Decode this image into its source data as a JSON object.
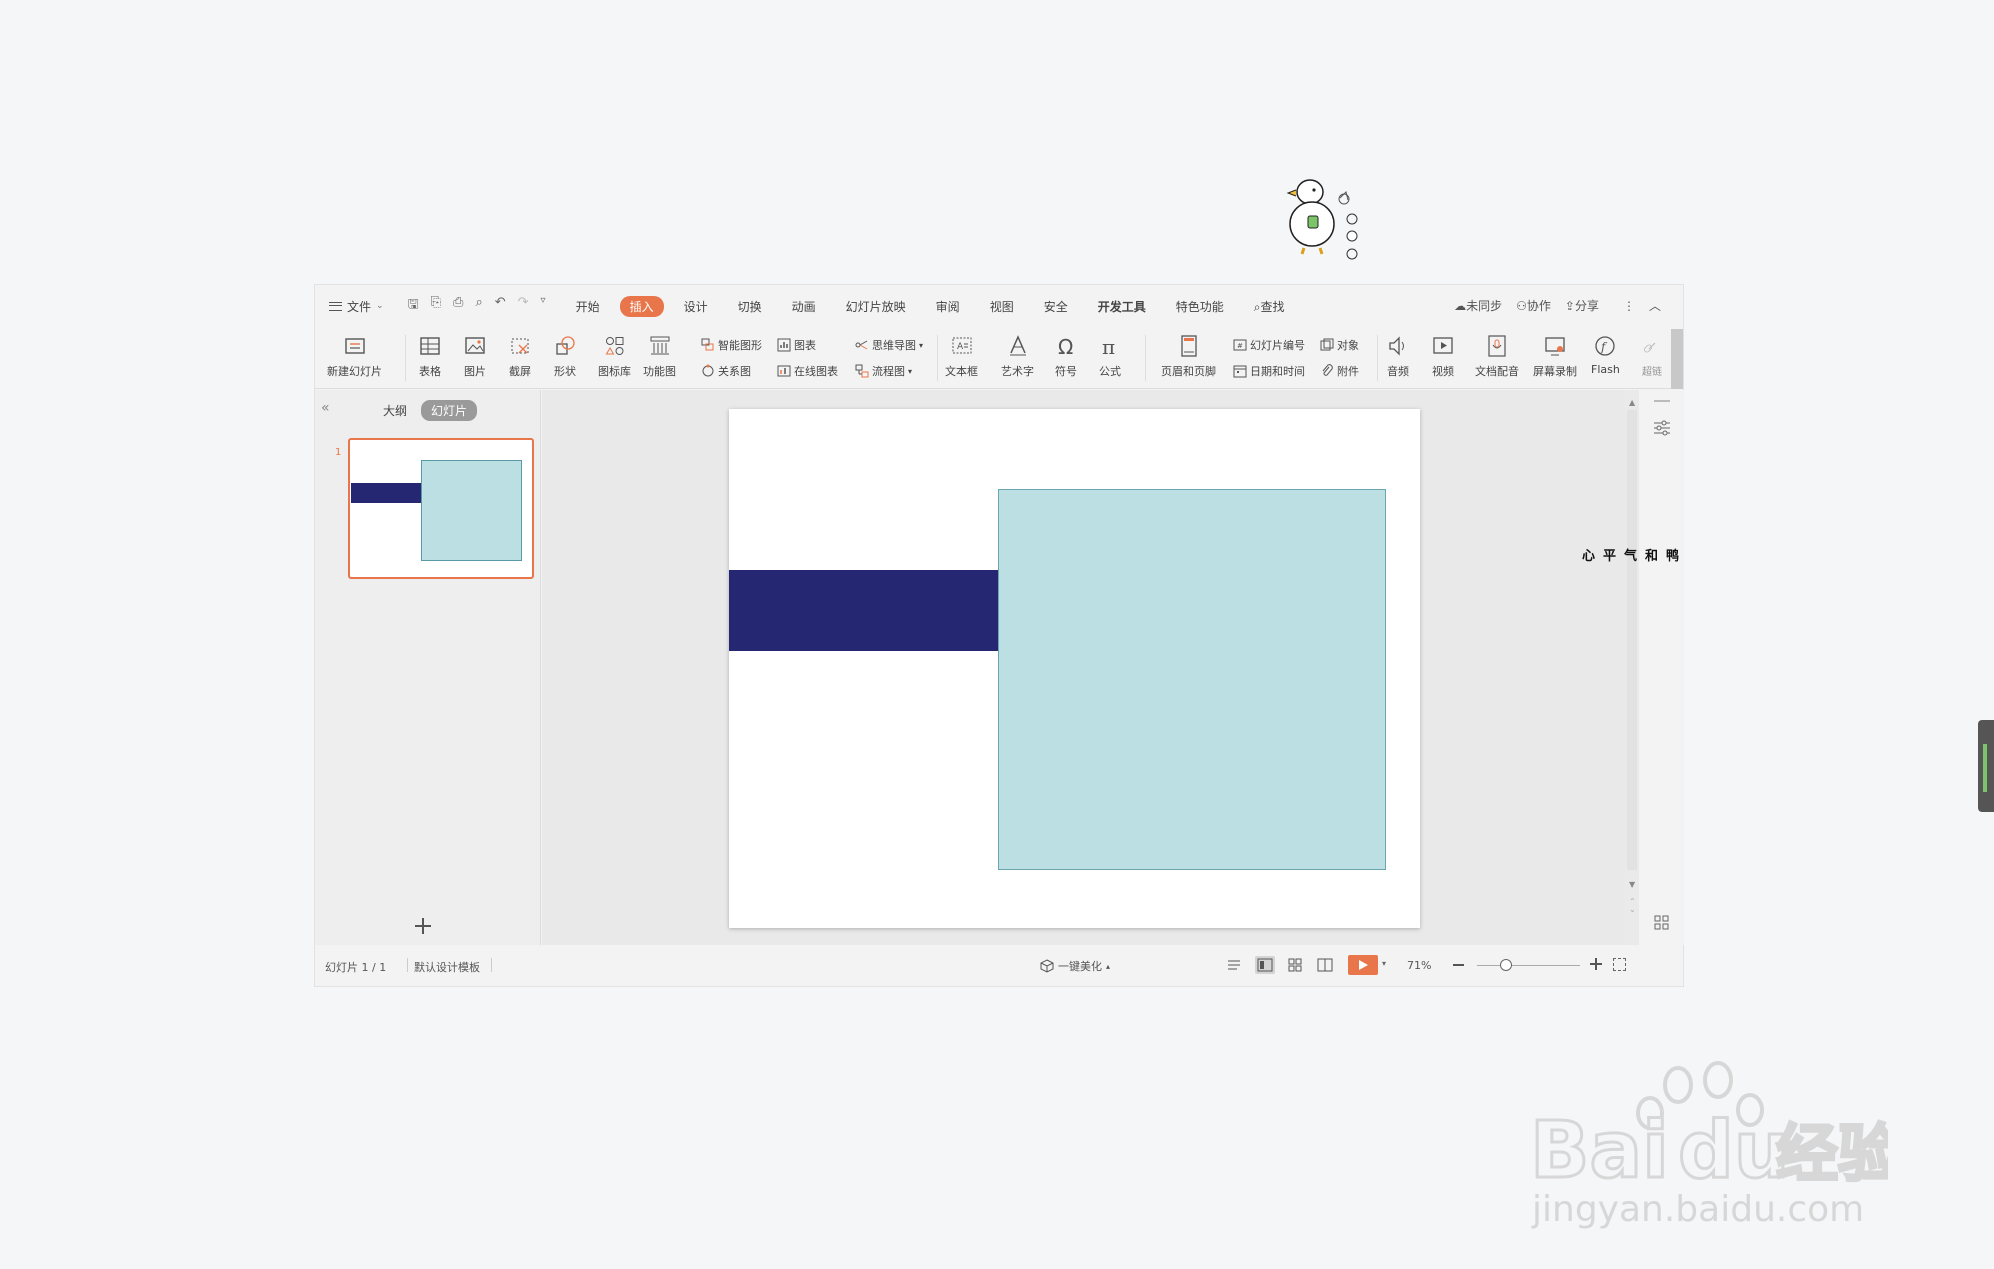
{
  "menubar": {
    "file_label": "文件",
    "tabs": [
      {
        "label": "开始"
      },
      {
        "label": "插入"
      },
      {
        "label": "设计"
      },
      {
        "label": "切换"
      },
      {
        "label": "动画"
      },
      {
        "label": "幻灯片放映"
      },
      {
        "label": "审阅"
      },
      {
        "label": "视图"
      },
      {
        "label": "安全"
      },
      {
        "label": "开发工具"
      },
      {
        "label": "特色功能"
      }
    ],
    "search_label": "查找",
    "sync_label": "未同步",
    "collab_label": "协作",
    "share_label": "分享"
  },
  "ribbon": {
    "new_slide": "新建幻灯片",
    "table": "表格",
    "picture": "图片",
    "screenshot": "截屏",
    "shape": "形状",
    "icon_lib": "图标库",
    "func_chart": "功能图",
    "smart_art": "智能图形",
    "chart": "图表",
    "relation": "关系图",
    "online_chart": "在线图表",
    "mindmap": "思维导图",
    "flowchart": "流程图",
    "textbox": "文本框",
    "wordart": "艺术字",
    "symbol": "符号",
    "formula": "公式",
    "header_footer": "页眉和页脚",
    "slide_number": "幻灯片编号",
    "object": "对象",
    "date_time": "日期和时间",
    "attachment": "附件",
    "audio": "音频",
    "video": "视频",
    "doc_dub": "文档配音",
    "screen_rec": "屏幕录制",
    "flash": "Flash",
    "hyperlink": "超链"
  },
  "leftpanel": {
    "outline_tab": "大纲",
    "slides_tab": "幻灯片",
    "thumb_number": "1"
  },
  "statusbar": {
    "slide_info": "幻灯片 1 / 1",
    "template": "默认设计模板",
    "beautify": "一键美化",
    "zoom": "71%"
  },
  "sticker": {
    "caption": "心平气和鸭"
  },
  "watermark": {
    "brand": "Baidu",
    "brand_cn": "经验",
    "url": "jingyan.baidu.com"
  },
  "colors": {
    "accent": "#e8764a",
    "navy_bar": "#262772",
    "teal_box": "#bbdfe2"
  }
}
